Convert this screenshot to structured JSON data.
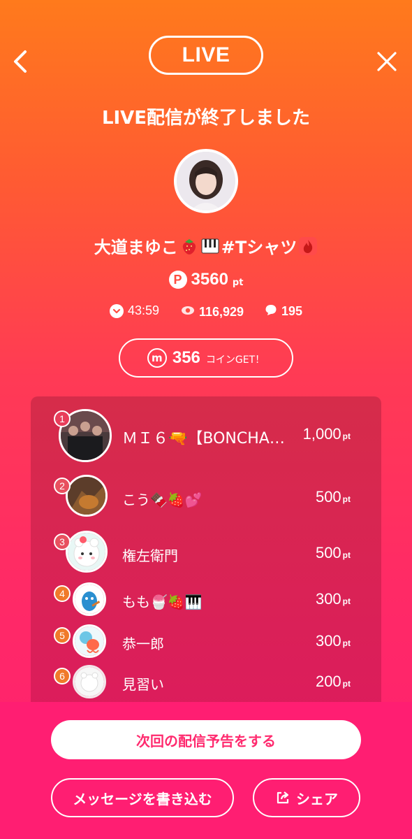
{
  "header": {
    "live_label": "LIVE",
    "back_icon": "chevron-left-icon",
    "close_icon": "close-icon"
  },
  "title": "LIVE配信が終了しました",
  "streamer": {
    "name": "大道まゆこ",
    "name_suffix": "#Tシャツ",
    "emojis": [
      "strawberry",
      "piano-keys",
      "fire"
    ]
  },
  "points": {
    "badge": "P",
    "value": "3560",
    "unit": "pt"
  },
  "stats": {
    "duration": "43:59",
    "viewers": "116,929",
    "comments": "195"
  },
  "coin": {
    "icon_letter": "m",
    "value": "356",
    "label": "コインGET！"
  },
  "ranking": [
    {
      "rank": "1",
      "name": "ＭＩ６🔫【BONCHA…",
      "points": "1,000",
      "unit": "pt",
      "badge_color": "#e83d5a"
    },
    {
      "rank": "2",
      "name": "こう🍫🍓💕",
      "points": "500",
      "unit": "pt",
      "badge_color": "#e8505f"
    },
    {
      "rank": "3",
      "name": "権左衛門",
      "points": "500",
      "unit": "pt",
      "badge_color": "#e8505f"
    },
    {
      "rank": "4",
      "name": "もも🍧🍓🎹",
      "points": "300",
      "unit": "pt",
      "badge_color": "#f07a2a"
    },
    {
      "rank": "5",
      "name": "恭一郎",
      "points": "300",
      "unit": "pt",
      "badge_color": "#f07a2a"
    },
    {
      "rank": "6",
      "name": "見習い",
      "points": "200",
      "unit": "pt",
      "badge_color": "#f07a2a"
    }
  ],
  "buttons": {
    "schedule": "次回の配信予告をする",
    "message": "メッセージを書き込む",
    "share": "シェア"
  }
}
